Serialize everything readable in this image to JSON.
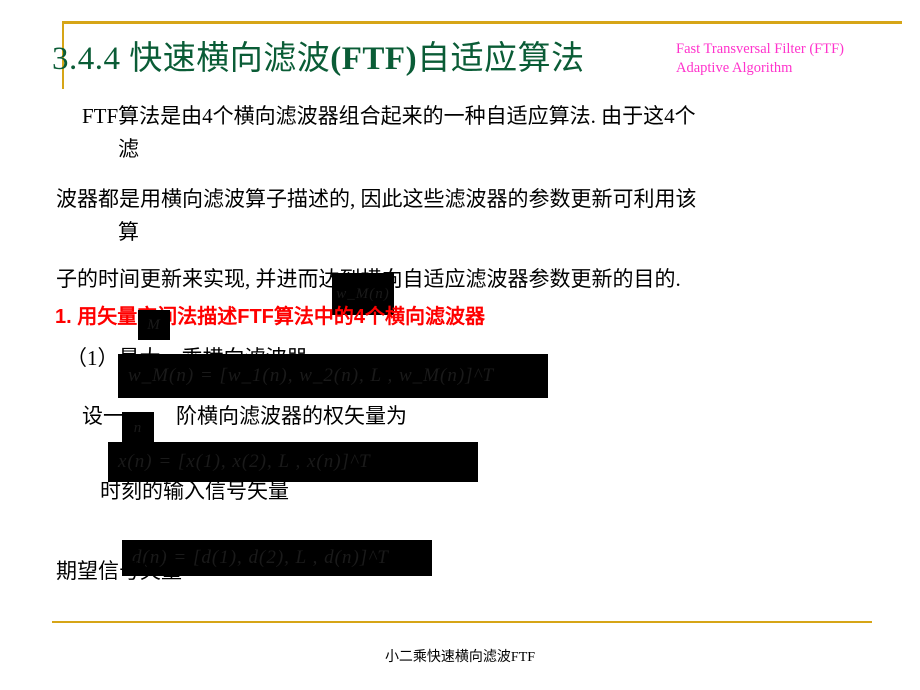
{
  "slide": {
    "title_cn_prefix": "3.4.4 ",
    "title_cn_a": "快速横向滤波",
    "title_cn_ftf": "(FTF)",
    "title_cn_b": "自适应算法",
    "title_en_line1": "Fast Transversal Filter (FTF)",
    "title_en_line2": "Adaptive Algorithm",
    "body": {
      "para1_line1": "FTF算法是由4个横向滤波器组合起来的一种自适应算法. 由于这4个",
      "para1_line2": "滤",
      "para2_line1": "波器都是用横向滤波算子描述的, 因此这些滤波器的参数更新可利用该",
      "para2_line2": "算",
      "para3_line1": "子的时间更新来实现, 并进而达到横向自适应滤波器参数更新的目的.",
      "heading_red": "1. 用矢量空间法描述FTF算法中的4个横向滤波器",
      "item1": "（1）最大一乘横向滤波器",
      "line_she": "设一",
      "line_jie": "阶横向滤波器的权矢量为",
      "line_shike": "时刻的输入信号矢量",
      "line_qiwang": "期望信号矢量"
    },
    "equations": {
      "wmn_inline": "w_M(n)",
      "M_inline": "M",
      "n_inline": "n",
      "weight_vector": "w_M(n) = [w_1(n),  w_2(n),  L ,  w_M(n)]^T",
      "input_vector": "x(n) = [x(1),  x(2),  L ,  x(n)]^T",
      "desired_vector": "d(n) = [d(1),  d(2),  L ,  d(n)]^T"
    },
    "footer_text": "小二乘快速横向滤波FTF",
    "colors": {
      "title_green": "#0a5c36",
      "title_magenta": "#ff33cc",
      "heading_red": "#ff0000",
      "rule_gold": "#d6a517",
      "equation_box": "#000000"
    }
  }
}
